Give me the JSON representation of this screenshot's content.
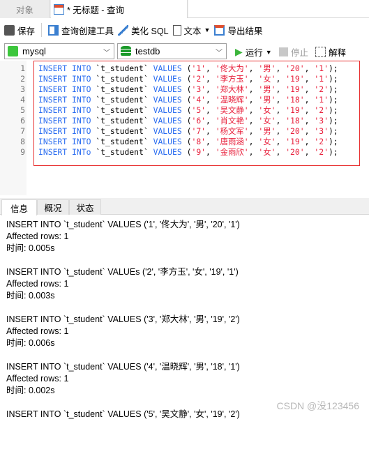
{
  "tabs": {
    "objects": "对象",
    "query": "* 无标题 - 查询"
  },
  "toolbar": {
    "save": "保存",
    "query_builder": "查询创建工具",
    "beautify": "美化 SQL",
    "text": "文本",
    "export": "导出结果"
  },
  "connection": {
    "selected": "mysql"
  },
  "database": {
    "selected": "testdb"
  },
  "run": {
    "run": "运行",
    "stop": "停止",
    "explain": "解释"
  },
  "colors": {
    "keyword": "#2a6cf0",
    "string": "#e8203c",
    "highlight_box": "#e83030"
  },
  "editor": {
    "lines": [
      {
        "n": "1",
        "k1": "INSERT INTO",
        "t": "`t_student`",
        "k2": "VALUES",
        "v": [
          "1",
          "佟大为",
          "男",
          "20",
          "1"
        ]
      },
      {
        "n": "2",
        "k1": "INSERT INTO",
        "t": "`t_student`",
        "k2": "VALUEs",
        "v": [
          "2",
          "李方玉",
          "女",
          "19",
          "1"
        ]
      },
      {
        "n": "3",
        "k1": "INSERT INTO",
        "t": "`t_student`",
        "k2": "VALUES",
        "v": [
          "3",
          "郑大林",
          "男",
          "19",
          "2"
        ]
      },
      {
        "n": "4",
        "k1": "INSERT INTO",
        "t": "`t_student`",
        "k2": "VALUES",
        "v": [
          "4",
          "温晓辉",
          "男",
          "18",
          "1"
        ]
      },
      {
        "n": "5",
        "k1": "INSERT INTO",
        "t": "`t_student`",
        "k2": "VALUES",
        "v": [
          "5",
          "吴文静",
          "女",
          "19",
          "2"
        ]
      },
      {
        "n": "6",
        "k1": "INSERT INTO",
        "t": "`t_student`",
        "k2": "VALUES",
        "v": [
          "6",
          "肖文艳",
          "女",
          "18",
          "3"
        ]
      },
      {
        "n": "7",
        "k1": "INSERT INTO",
        "t": "`t_student`",
        "k2": "VALUES",
        "v": [
          "7",
          "杨文军",
          "男",
          "20",
          "3"
        ]
      },
      {
        "n": "8",
        "k1": "INSERT INTO",
        "t": "`t_student`",
        "k2": "VALUES",
        "v": [
          "8",
          "唐雨涵",
          "女",
          "19",
          "2"
        ]
      },
      {
        "n": "9",
        "k1": "INSERT INTo",
        "t": "`t_student`",
        "k2": "VALUES",
        "v": [
          "9",
          "金雨欣",
          "女",
          "20",
          "2"
        ]
      }
    ]
  },
  "result_tabs": [
    "信息",
    "概况",
    "状态"
  ],
  "messages": [
    {
      "sql": "INSERT INTO `t_student` VALUES ('1', '佟大为', '男', '20', '1')",
      "affected": "Affected rows: 1",
      "time": "时间: 0.005s"
    },
    {
      "sql": "INSERT INTO `t_student` VALUEs ('2', '李方玉', '女', '19', '1')",
      "affected": "Affected rows: 1",
      "time": "时间: 0.003s"
    },
    {
      "sql": "INSERT INTO `t_student` VALUES ('3', '郑大林', '男', '19', '2')",
      "affected": "Affected rows: 1",
      "time": "时间: 0.006s"
    },
    {
      "sql": "INSERT INTO `t_student` VALUES ('4', '温晓辉', '男', '18', '1')",
      "affected": "Affected rows: 1",
      "time": "时间: 0.002s"
    },
    {
      "sql": "INSERT INTO `t_student` VALUES ('5', '吴文静', '女', '19', '2')",
      "affected": "",
      "time": ""
    }
  ],
  "watermark": "CSDN @没123456"
}
